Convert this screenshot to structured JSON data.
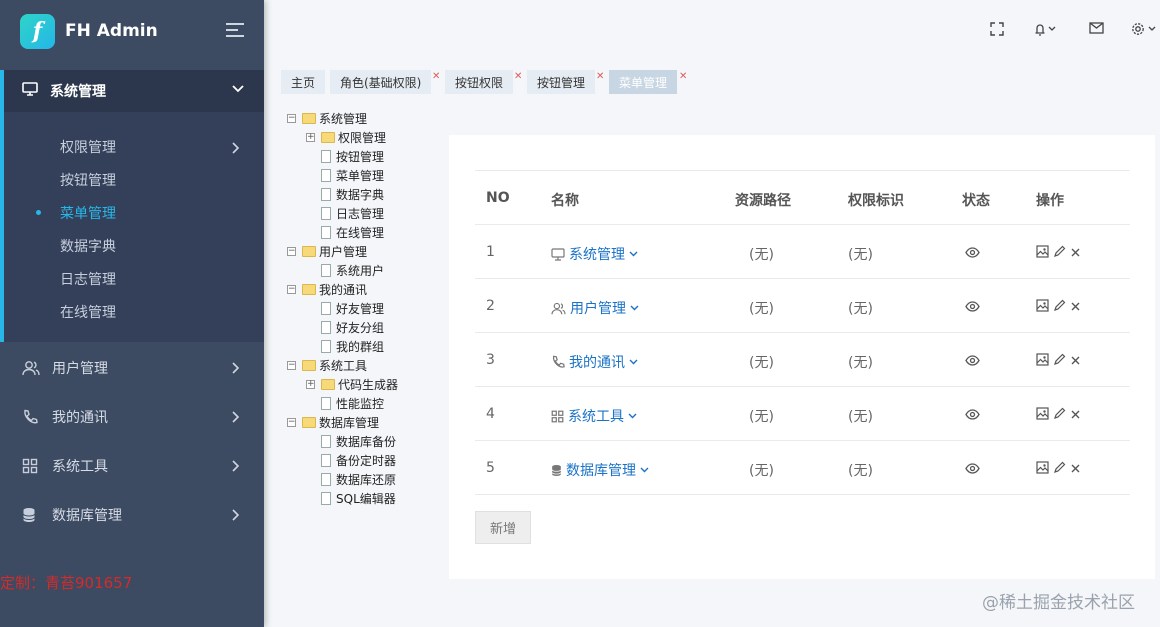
{
  "brand": {
    "name": "FH Admin",
    "logo_letter": "f"
  },
  "sidebar": {
    "open_group": {
      "label": "系统管理",
      "items": [
        {
          "label": "权限管理",
          "has_children": true
        },
        {
          "label": "按钮管理"
        },
        {
          "label": "菜单管理",
          "active": true
        },
        {
          "label": "数据字典"
        },
        {
          "label": "日志管理"
        },
        {
          "label": "在线管理"
        }
      ]
    },
    "groups": [
      {
        "label": "用户管理",
        "icon": "users-icon"
      },
      {
        "label": "我的通讯",
        "icon": "phone-icon"
      },
      {
        "label": "系统工具",
        "icon": "grid-icon"
      },
      {
        "label": "数据库管理",
        "icon": "database-icon"
      }
    ],
    "watermark": "定制：青苔901657"
  },
  "tabs": [
    {
      "label": "主页",
      "closable": false
    },
    {
      "label": "角色(基础权限)",
      "closable": true
    },
    {
      "label": "按钮权限",
      "closable": true
    },
    {
      "label": "按钮管理",
      "closable": true
    },
    {
      "label": "菜单管理",
      "closable": true,
      "active": true
    }
  ],
  "tree": [
    {
      "label": "系统管理",
      "type": "folder",
      "level": 0,
      "toggle": "−"
    },
    {
      "label": "权限管理",
      "type": "folder",
      "level": 1,
      "toggle": "+"
    },
    {
      "label": "按钮管理",
      "type": "file",
      "level": 1
    },
    {
      "label": "菜单管理",
      "type": "file",
      "level": 1
    },
    {
      "label": "数据字典",
      "type": "file",
      "level": 1
    },
    {
      "label": "日志管理",
      "type": "file",
      "level": 1
    },
    {
      "label": "在线管理",
      "type": "file",
      "level": 1
    },
    {
      "label": "用户管理",
      "type": "folder",
      "level": 0,
      "toggle": "−"
    },
    {
      "label": "系统用户",
      "type": "file",
      "level": 1
    },
    {
      "label": "我的通讯",
      "type": "folder",
      "level": 0,
      "toggle": "−"
    },
    {
      "label": "好友管理",
      "type": "file",
      "level": 1
    },
    {
      "label": "好友分组",
      "type": "file",
      "level": 1
    },
    {
      "label": "我的群组",
      "type": "file",
      "level": 1
    },
    {
      "label": "系统工具",
      "type": "folder",
      "level": 0,
      "toggle": "−"
    },
    {
      "label": "代码生成器",
      "type": "folder",
      "level": 1,
      "toggle": "+"
    },
    {
      "label": "性能监控",
      "type": "file",
      "level": 1
    },
    {
      "label": "数据库管理",
      "type": "folder",
      "level": 0,
      "toggle": "−"
    },
    {
      "label": "数据库备份",
      "type": "file",
      "level": 1
    },
    {
      "label": "备份定时器",
      "type": "file",
      "level": 1
    },
    {
      "label": "数据库还原",
      "type": "file",
      "level": 1
    },
    {
      "label": "SQL编辑器",
      "type": "file",
      "level": 1
    }
  ],
  "table": {
    "headers": {
      "no": "NO",
      "name": "名称",
      "path": "资源路径",
      "perm": "权限标识",
      "status": "状态",
      "ops": "操作"
    },
    "rows": [
      {
        "no": "1",
        "name": "系统管理",
        "icon": "monitor-icon",
        "path": "(无)",
        "perm": "(无)"
      },
      {
        "no": "2",
        "name": "用户管理",
        "icon": "users-icon",
        "path": "(无)",
        "perm": "(无)"
      },
      {
        "no": "3",
        "name": "我的通讯",
        "icon": "phone-icon",
        "path": "(无)",
        "perm": "(无)"
      },
      {
        "no": "4",
        "name": "系统工具",
        "icon": "grid-icon",
        "path": "(无)",
        "perm": "(无)"
      },
      {
        "no": "5",
        "name": "数据库管理",
        "icon": "database-icon",
        "path": "(无)",
        "perm": "(无)"
      }
    ]
  },
  "add_button": "新增",
  "site_mark": "@稀土掘金技术社区"
}
